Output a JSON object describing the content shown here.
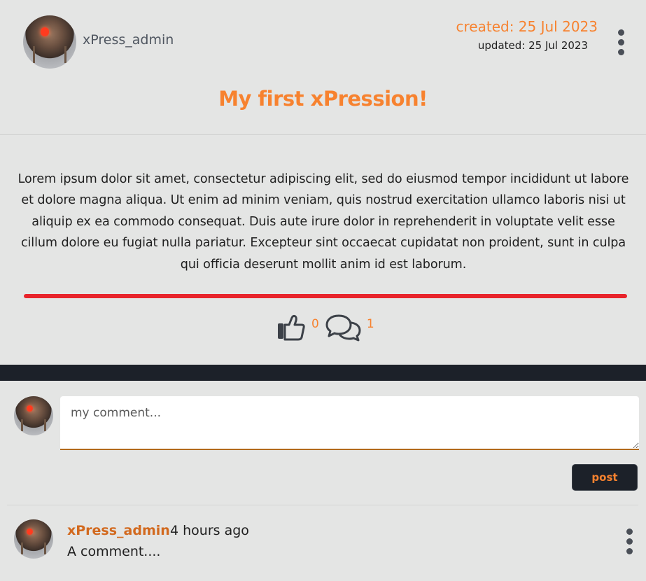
{
  "post": {
    "author": "xPress_admin",
    "created": "created: 25 Jul 2023",
    "updated": "updated: 25 Jul 2023",
    "title": "My first xPression!",
    "body": "Lorem ipsum dolor sit amet, consectetur adipiscing elit, sed do eiusmod tempor incididunt ut labore et dolore magna aliqua. Ut enim ad minim veniam, quis nostrud exercitation ullamco laboris nisi ut aliquip ex ea commodo consequat. Duis aute irure dolor in reprehenderit in voluptate velit esse cillum dolore eu fugiat nulla pariatur. Excepteur sint occaecat cupidatat non proident, sunt in culpa qui officia deserunt mollit anim id est laborum.",
    "likes": "0",
    "comments_count": "1",
    "like_icon": "thumbs-up-icon",
    "comment_icon": "comments-icon"
  },
  "comment_form": {
    "placeholder": "my comment...",
    "value": "",
    "submit_label": "post"
  },
  "comments": [
    {
      "author": "xPress_admin",
      "time": "4 hours ago",
      "text": "A comment...."
    }
  ],
  "colors": {
    "accent": "#f7822f",
    "accent_dark": "#d2691e",
    "dark_band": "#1c2129",
    "background": "#e4e5e4",
    "divider_red": "#e8242b"
  }
}
